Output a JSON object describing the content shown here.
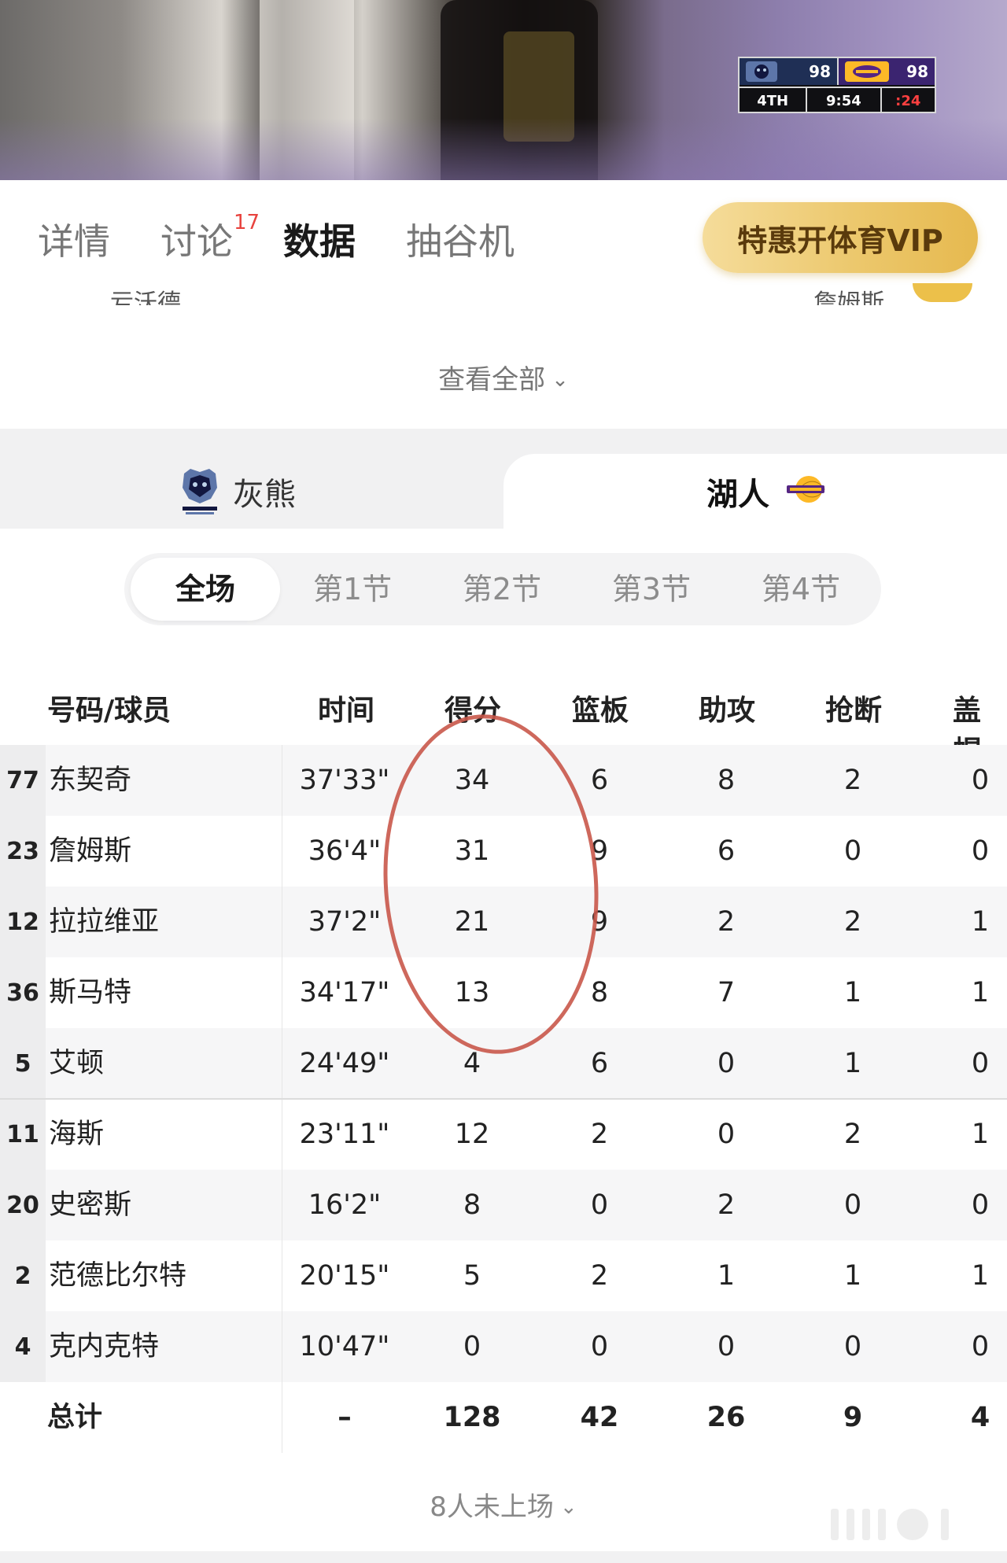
{
  "scorebug": {
    "home_score": "98",
    "away_score": "98",
    "quarter": "4TH",
    "clock": "9:54",
    "shot_clock": ":24"
  },
  "tabs": [
    {
      "label": "详情"
    },
    {
      "label": "讨论",
      "badge": "17"
    },
    {
      "label": "数据"
    },
    {
      "label": "抽谷机"
    }
  ],
  "vip_button": "特惠开体育VIP",
  "peek": {
    "left": "亏沃德",
    "right": "詹姆斯"
  },
  "view_all": "查看全部",
  "teams": {
    "left": "灰熊",
    "right": "湖人"
  },
  "periods": [
    "全场",
    "第1节",
    "第2节",
    "第3节",
    "第4节"
  ],
  "columns": [
    "号码/球员",
    "时间",
    "得分",
    "篮板",
    "助攻",
    "抢断",
    "盖帽"
  ],
  "players": [
    {
      "num": "77",
      "name": "东契奇",
      "time": "37'33\"",
      "pts": "34",
      "reb": "6",
      "ast": "8",
      "stl": "2",
      "blk": "0"
    },
    {
      "num": "23",
      "name": "詹姆斯",
      "time": "36'4\"",
      "pts": "31",
      "reb": "9",
      "ast": "6",
      "stl": "0",
      "blk": "0"
    },
    {
      "num": "12",
      "name": "拉拉维亚",
      "time": "37'2\"",
      "pts": "21",
      "reb": "9",
      "ast": "2",
      "stl": "2",
      "blk": "1"
    },
    {
      "num": "36",
      "name": "斯马特",
      "time": "34'17\"",
      "pts": "13",
      "reb": "8",
      "ast": "7",
      "stl": "1",
      "blk": "1"
    },
    {
      "num": "5",
      "name": "艾顿",
      "time": "24'49\"",
      "pts": "4",
      "reb": "6",
      "ast": "0",
      "stl": "1",
      "blk": "0"
    },
    {
      "num": "11",
      "name": "海斯",
      "time": "23'11\"",
      "pts": "12",
      "reb": "2",
      "ast": "0",
      "stl": "2",
      "blk": "1"
    },
    {
      "num": "20",
      "name": "史密斯",
      "time": "16'2\"",
      "pts": "8",
      "reb": "0",
      "ast": "2",
      "stl": "0",
      "blk": "0"
    },
    {
      "num": "2",
      "name": "范德比尔特",
      "time": "20'15\"",
      "pts": "5",
      "reb": "2",
      "ast": "1",
      "stl": "1",
      "blk": "1"
    },
    {
      "num": "4",
      "name": "克内克特",
      "time": "10'47\"",
      "pts": "0",
      "reb": "0",
      "ast": "0",
      "stl": "0",
      "blk": "0"
    }
  ],
  "total": {
    "label": "总计",
    "time": "–",
    "pts": "128",
    "reb": "42",
    "ast": "26",
    "stl": "9",
    "blk": "4"
  },
  "not_played": "8人未上场",
  "colors": {
    "accent_gold": "#ecc86d",
    "badge_red": "#e8433e",
    "circle_red": "#c9584a"
  }
}
